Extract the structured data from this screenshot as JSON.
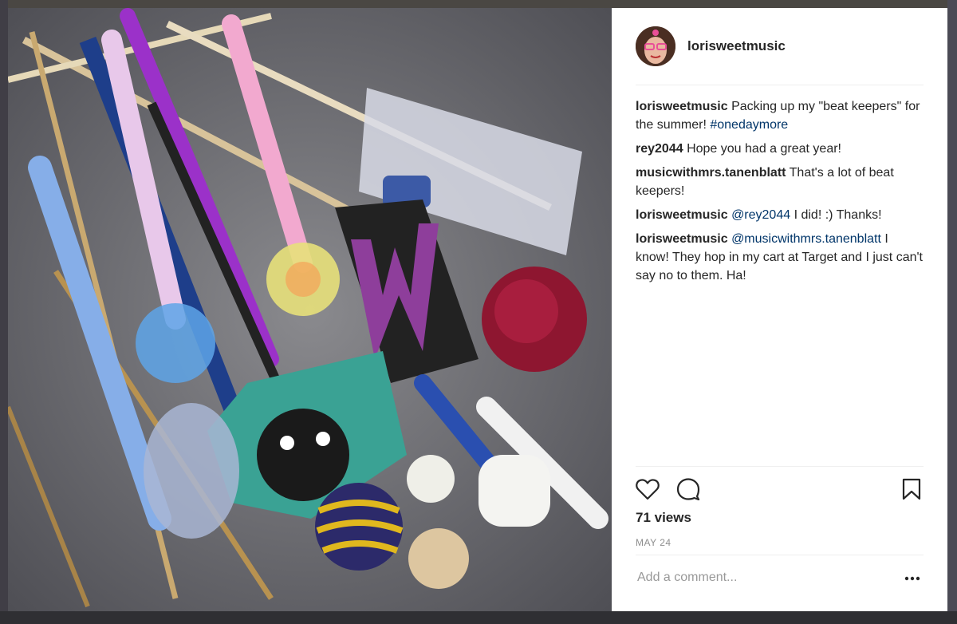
{
  "post": {
    "username": "lorisweetmusic",
    "caption": {
      "user": "lorisweetmusic",
      "text": "Packing up my \"beat keepers\" for the summer! ",
      "hashtag": "#onedaymore"
    },
    "comments": [
      {
        "user": "rey2044",
        "text": "Hope you had a great year!"
      },
      {
        "user": "musicwithmrs.tanenblatt",
        "text": "That's a lot of beat keepers!"
      },
      {
        "user": "lorisweetmusic",
        "mention": "@rey2044",
        "text": " I did! :) Thanks!"
      },
      {
        "user": "lorisweetmusic",
        "mention": "@musicwithmrs.tanenblatt",
        "text": " I know! They hop in my cart at Target and I just can't say no to them. Ha!"
      }
    ],
    "views": "71 views",
    "date": "MAY 24",
    "comment_placeholder": "Add a comment...",
    "icons": {
      "like": "heart-icon",
      "comment": "comment-bubble-icon",
      "save": "bookmark-icon",
      "more": "more-options-icon"
    },
    "colors": {
      "text": "#262626",
      "link": "#003569",
      "muted": "#8e8e8e",
      "divider": "#efefef"
    }
  }
}
